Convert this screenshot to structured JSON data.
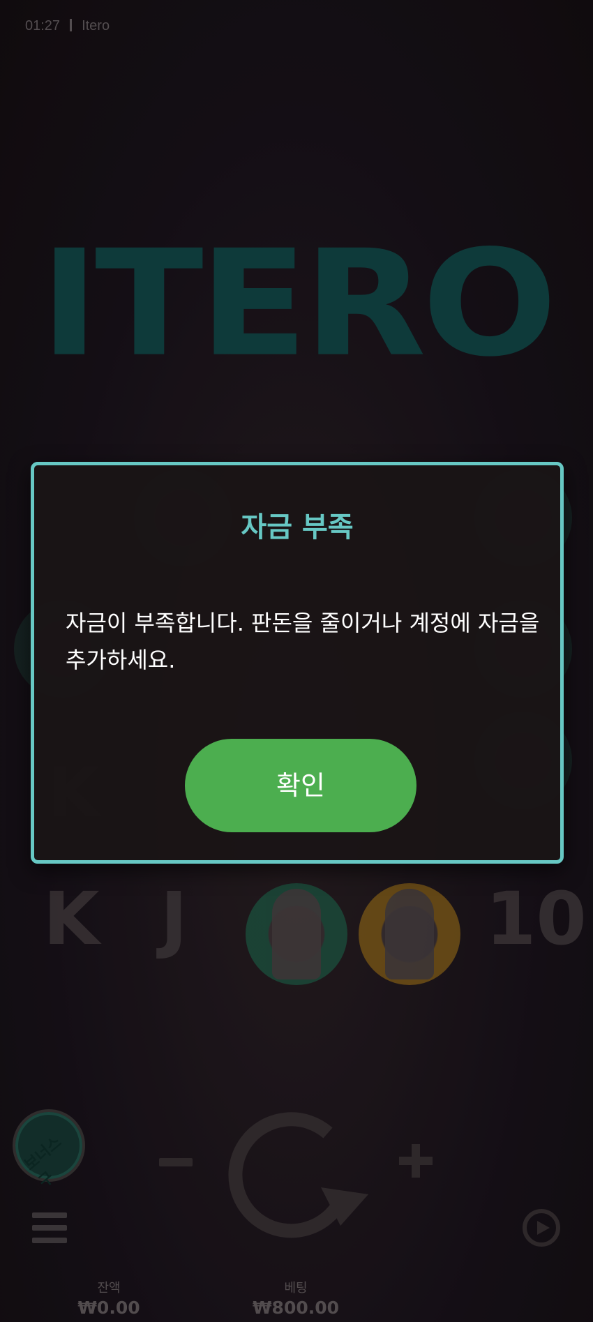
{
  "status_bar": {
    "time": "01:27",
    "game_name": "Itero"
  },
  "logo": {
    "text": "ITERO"
  },
  "reels": {
    "row4": [
      "K",
      "J",
      "bust",
      "bust",
      "10"
    ]
  },
  "dialog": {
    "title": "자금 부족",
    "message": "자금이 부족합니다. 판돈을 줄이거나 계정에 자금을 추가하세요.",
    "confirm_label": "확인"
  },
  "controls": {
    "bonus_label": "보너스 구",
    "balance_label": "잔액",
    "balance_value": "₩0.00",
    "bet_label": "베팅",
    "bet_value": "₩800.00"
  },
  "colors": {
    "accent": "#67c8c4",
    "confirm_button": "#4cae4f",
    "logo": "#0f4b4b"
  }
}
